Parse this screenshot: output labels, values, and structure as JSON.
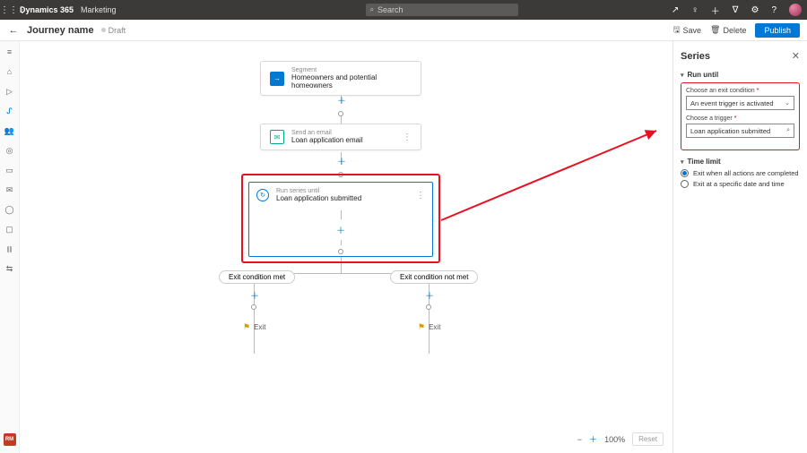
{
  "topbar": {
    "brand": "Dynamics 365",
    "area": "Marketing",
    "search_placeholder": "Search"
  },
  "cmdbar": {
    "title": "Journey name",
    "status": "Draft",
    "save": "Save",
    "delete": "Delete",
    "publish": "Publish"
  },
  "leftnav": {
    "rm": "RM"
  },
  "canvas": {
    "segment": {
      "line1": "Segment",
      "line2": "Homeowners and potential homeowners"
    },
    "email": {
      "line1": "Send an email",
      "line2": "Loan application email"
    },
    "series": {
      "line1": "Run series until",
      "line2": "Loan application submitted"
    },
    "cond_met": "Exit condition met",
    "cond_notmet": "Exit condition not met",
    "exit_left": "Exit",
    "exit_right": "Exit",
    "zoom": "100%",
    "reset": "Reset"
  },
  "panel": {
    "title": "Series",
    "run_until": "Run until",
    "exit_cond_label": "Choose an exit condition",
    "exit_cond_value": "An event trigger is activated",
    "trigger_label": "Choose a trigger",
    "trigger_value": "Loan application submitted",
    "time_limit": "Time limit",
    "radio1": "Exit when all actions are completed",
    "radio2": "Exit at a specific date and time"
  }
}
